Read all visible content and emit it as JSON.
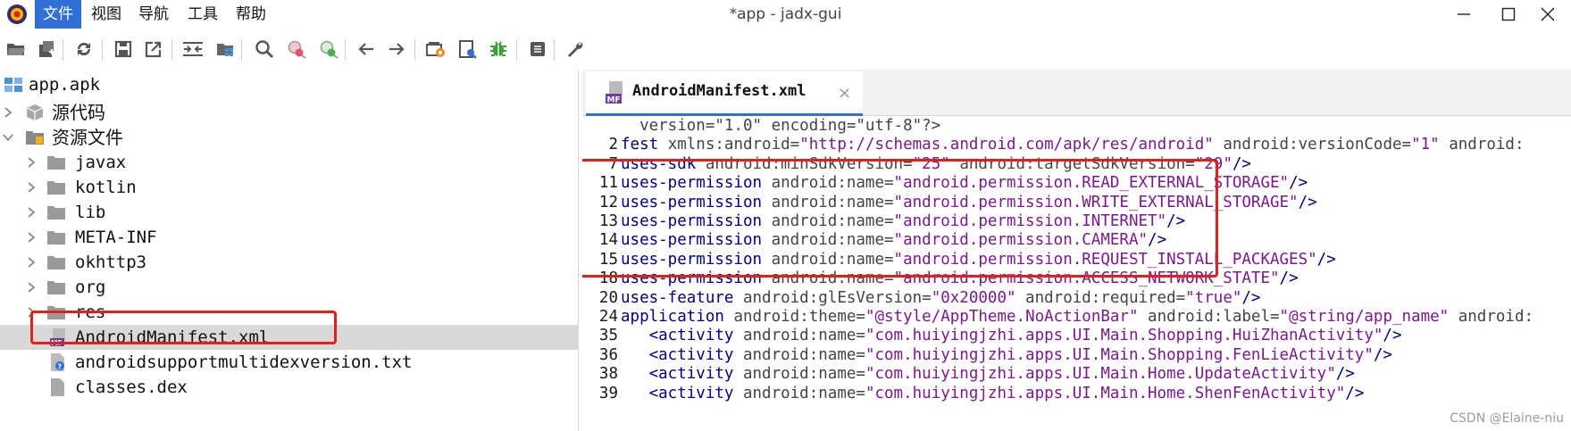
{
  "window": {
    "title": "*app - jadx-gui"
  },
  "menu": {
    "items": [
      "文件",
      "视图",
      "导航",
      "工具",
      "帮助"
    ]
  },
  "tree": {
    "root": "app.apk",
    "source_code": "源代码",
    "resources": "资源文件",
    "folders": [
      "javax",
      "kotlin",
      "lib",
      "META-INF",
      "okhttp3",
      "org",
      "res"
    ],
    "files": [
      "AndroidManifest.xml",
      "androidsupportmultidexversion.txt",
      "classes.dex"
    ]
  },
  "editor": {
    "tab_label": "AndroidManifest.xml",
    "lines": [
      {
        "num": "",
        "parts": [
          {
            "cls": "c-text",
            "t": "  version=\"1.0\" encoding=\"utf-8\"?>"
          }
        ]
      },
      {
        "num": "2",
        "parts": [
          {
            "cls": "c-tag",
            "t": "fest "
          },
          {
            "cls": "c-attr",
            "t": "xmlns:android="
          },
          {
            "cls": "c-val",
            "t": "\"http://schemas.android.com/apk/res/android\""
          },
          {
            "cls": "c-attr",
            "t": " android:versionCode="
          },
          {
            "cls": "c-val",
            "t": "\"1\""
          },
          {
            "cls": "c-attr",
            "t": " android:"
          }
        ]
      },
      {
        "num": "7",
        "parts": [
          {
            "cls": "c-tag",
            "t": "uses-sdk "
          },
          {
            "cls": "c-attr",
            "t": "android:minSdkVersion="
          },
          {
            "cls": "c-val",
            "t": "\"25\""
          },
          {
            "cls": "c-attr",
            "t": " android:targetSdkVersion="
          },
          {
            "cls": "c-val",
            "t": "\"29\""
          },
          {
            "cls": "c-tag",
            "t": "/>"
          }
        ]
      },
      {
        "num": "11",
        "parts": [
          {
            "cls": "c-tag",
            "t": "uses-permission "
          },
          {
            "cls": "c-attr",
            "t": "android:name="
          },
          {
            "cls": "c-val",
            "t": "\"android.permission.READ_EXTERNAL_STORAGE\""
          },
          {
            "cls": "c-tag",
            "t": "/>"
          }
        ]
      },
      {
        "num": "12",
        "parts": [
          {
            "cls": "c-tag",
            "t": "uses-permission "
          },
          {
            "cls": "c-attr",
            "t": "android:name="
          },
          {
            "cls": "c-val",
            "t": "\"android.permission.WRITE_EXTERNAL_STORAGE\""
          },
          {
            "cls": "c-tag",
            "t": "/>"
          }
        ]
      },
      {
        "num": "13",
        "parts": [
          {
            "cls": "c-tag",
            "t": "uses-permission "
          },
          {
            "cls": "c-attr",
            "t": "android:name="
          },
          {
            "cls": "c-val",
            "t": "\"android.permission.INTERNET\""
          },
          {
            "cls": "c-tag",
            "t": "/>"
          }
        ]
      },
      {
        "num": "14",
        "parts": [
          {
            "cls": "c-tag",
            "t": "uses-permission "
          },
          {
            "cls": "c-attr",
            "t": "android:name="
          },
          {
            "cls": "c-val",
            "t": "\"android.permission.CAMERA\""
          },
          {
            "cls": "c-tag",
            "t": "/>"
          }
        ]
      },
      {
        "num": "15",
        "parts": [
          {
            "cls": "c-tag",
            "t": "uses-permission "
          },
          {
            "cls": "c-attr",
            "t": "android:name="
          },
          {
            "cls": "c-val",
            "t": "\"android.permission.REQUEST_INSTALL_PACKAGES\""
          },
          {
            "cls": "c-tag",
            "t": "/>"
          }
        ]
      },
      {
        "num": "18",
        "parts": [
          {
            "cls": "c-tag",
            "t": "uses-permission "
          },
          {
            "cls": "c-attr",
            "t": "android:name="
          },
          {
            "cls": "c-val",
            "t": "\"android.permission.ACCESS_NETWORK_STATE\""
          },
          {
            "cls": "c-tag",
            "t": "/>"
          }
        ]
      },
      {
        "num": "20",
        "parts": [
          {
            "cls": "c-tag",
            "t": "uses-feature "
          },
          {
            "cls": "c-attr",
            "t": "android:glEsVersion="
          },
          {
            "cls": "c-val",
            "t": "\"0x20000\""
          },
          {
            "cls": "c-attr",
            "t": " android:required="
          },
          {
            "cls": "c-val",
            "t": "\"true\""
          },
          {
            "cls": "c-tag",
            "t": "/>"
          }
        ]
      },
      {
        "num": "24",
        "parts": [
          {
            "cls": "c-tag",
            "t": "application "
          },
          {
            "cls": "c-attr",
            "t": "android:theme="
          },
          {
            "cls": "c-val",
            "t": "\"@style/AppTheme.NoActionBar\""
          },
          {
            "cls": "c-attr",
            "t": " android:label="
          },
          {
            "cls": "c-val",
            "t": "\"@string/app_name\""
          },
          {
            "cls": "c-attr",
            "t": " android:"
          }
        ]
      },
      {
        "num": "35",
        "parts": [
          {
            "cls": "c-tag",
            "t": "   <activity "
          },
          {
            "cls": "c-attr",
            "t": "android:name="
          },
          {
            "cls": "c-val",
            "t": "\"com.huiyingjzhi.apps.UI.Main.Shopping.HuiZhanActivity\""
          },
          {
            "cls": "c-tag",
            "t": "/>"
          }
        ]
      },
      {
        "num": "36",
        "parts": [
          {
            "cls": "c-tag",
            "t": "   <activity "
          },
          {
            "cls": "c-attr",
            "t": "android:name="
          },
          {
            "cls": "c-val",
            "t": "\"com.huiyingjzhi.apps.UI.Main.Shopping.FenLieActivity\""
          },
          {
            "cls": "c-tag",
            "t": "/>"
          }
        ]
      },
      {
        "num": "38",
        "parts": [
          {
            "cls": "c-tag",
            "t": "   <activity "
          },
          {
            "cls": "c-attr",
            "t": "android:name="
          },
          {
            "cls": "c-val",
            "t": "\"com.huiyingjzhi.apps.UI.Main.Home.UpdateActivity\""
          },
          {
            "cls": "c-tag",
            "t": "/>"
          }
        ]
      },
      {
        "num": "39",
        "parts": [
          {
            "cls": "c-tag",
            "t": "   <activity "
          },
          {
            "cls": "c-attr",
            "t": "android:name="
          },
          {
            "cls": "c-val",
            "t": "\"com.huiyingjzhi.apps.UI.Main.Home.ShenFenActivity\""
          },
          {
            "cls": "c-tag",
            "t": "/>"
          }
        ]
      }
    ]
  },
  "watermark": "CSDN @Elaine-niu",
  "colors": {
    "accent": "#2f6fd6",
    "highlight": "#e0201b",
    "selection": "#d9d9d9"
  },
  "icons": {
    "toolbar": [
      "open-folder-icon",
      "add-file-icon",
      "sync-icon",
      "save-icon",
      "export-icon",
      "sync-tree-icon",
      "flatten-packages-icon",
      "search-icon",
      "search-class-icon",
      "search-usage-icon",
      "back-icon",
      "forward-icon",
      "deobfuscation-icon",
      "log-icon",
      "debug-icon",
      "info-icon",
      "settings-icon"
    ]
  }
}
